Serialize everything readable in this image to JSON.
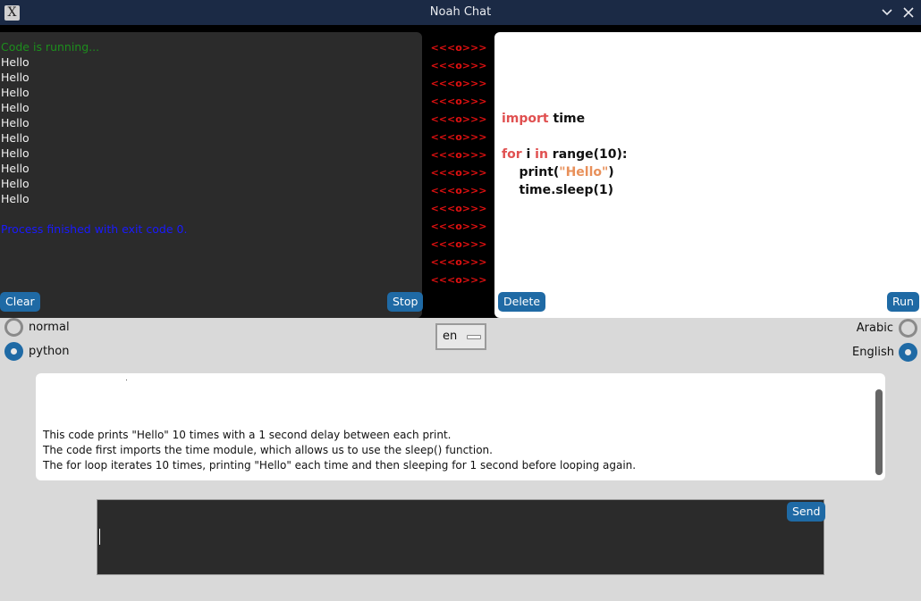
{
  "window": {
    "title": "Noah Chat",
    "app_icon": "X",
    "minimize_icon": "chevron-down",
    "close_icon": "close"
  },
  "console": {
    "lines": [
      {
        "text": "Code is running...",
        "kind": "running"
      },
      {
        "text": "Hello",
        "kind": "output"
      },
      {
        "text": "Hello",
        "kind": "output"
      },
      {
        "text": "Hello",
        "kind": "output"
      },
      {
        "text": "Hello",
        "kind": "output"
      },
      {
        "text": "Hello",
        "kind": "output"
      },
      {
        "text": "Hello",
        "kind": "output"
      },
      {
        "text": "Hello",
        "kind": "output"
      },
      {
        "text": "Hello",
        "kind": "output"
      },
      {
        "text": "Hello",
        "kind": "output"
      },
      {
        "text": "Hello",
        "kind": "output"
      },
      {
        "text": "",
        "kind": "output"
      },
      {
        "text": "Process finished with exit code 0.",
        "kind": "exit"
      }
    ],
    "clear_label": "Clear",
    "stop_label": "Stop"
  },
  "separator": {
    "marker": "<<<o>>>",
    "count": 14
  },
  "editor": {
    "code_lines": [
      [],
      [],
      [
        {
          "t": "import",
          "k": "kw"
        },
        {
          "t": " time",
          "k": ""
        }
      ],
      [],
      [
        {
          "t": "for",
          "k": "kw"
        },
        {
          "t": " i ",
          "k": ""
        },
        {
          "t": "in",
          "k": "kw"
        },
        {
          "t": " range(10):",
          "k": ""
        }
      ],
      [
        {
          "t": "    print(",
          "k": ""
        },
        {
          "t": "\"Hello\"",
          "k": "str"
        },
        {
          "t": ")",
          "k": ""
        }
      ],
      [
        {
          "t": "    time.sleep(1)",
          "k": ""
        }
      ]
    ],
    "delete_label": "Delete",
    "run_label": "Run"
  },
  "mode": {
    "options": [
      {
        "label": "normal",
        "selected": false
      },
      {
        "label": "python",
        "selected": true
      }
    ]
  },
  "language": {
    "selected": "en",
    "options": [
      {
        "label": "Arabic",
        "selected": false
      },
      {
        "label": "English",
        "selected": true
      }
    ]
  },
  "explanation": {
    "lines": [
      "This code prints \"Hello\" 10 times with a 1 second delay between each print.",
      "The code first imports the time module, which allows us to use the sleep() function.",
      "The for loop iterates 10 times, printing \"Hello\" each time and then sleeping for 1 second before looping again."
    ]
  },
  "chat_input": {
    "value": "",
    "send_label": "Send"
  },
  "colors": {
    "accent": "#1f6aa5",
    "titlebar": "#1b2a45",
    "console_bg": "#2b2b2b",
    "keyword": "#e05050",
    "string": "#e8905a",
    "running": "#1d8e1d",
    "exit": "#1a1aff",
    "separator": "#e01010"
  }
}
